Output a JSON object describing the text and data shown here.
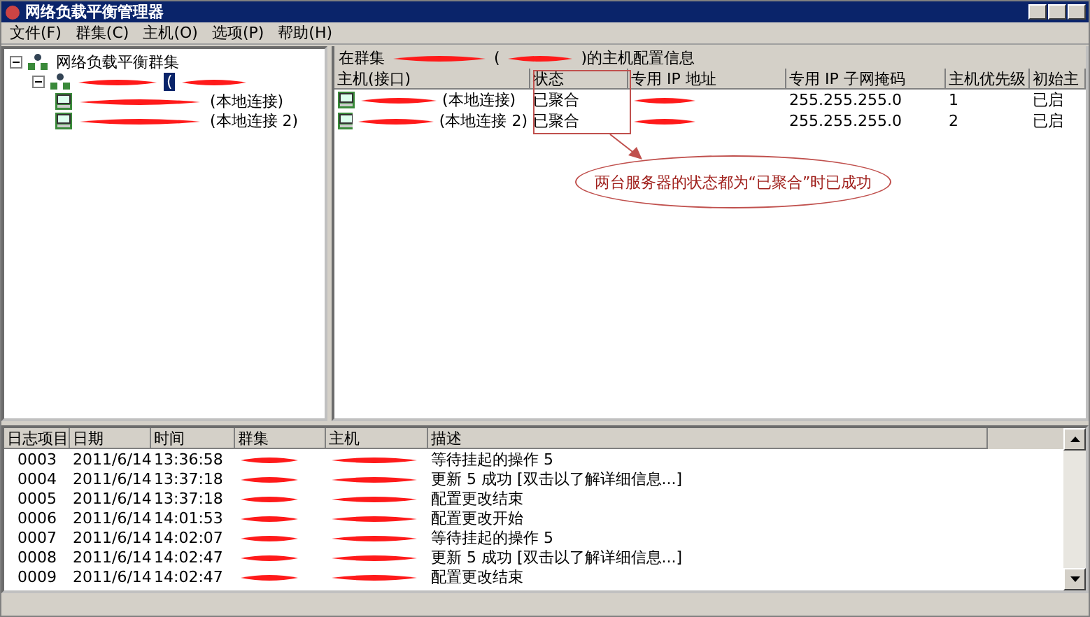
{
  "window": {
    "title": "网络负载平衡管理器"
  },
  "menu": [
    "文件(F)",
    "群集(C)",
    "主机(O)",
    "选项(P)",
    "帮助(H)"
  ],
  "tree": {
    "label": "网络负载平衡群集",
    "expanded": true,
    "children": [
      {
        "label": "(",
        "selected": true,
        "expanded": true,
        "children": [
          {
            "label": "(本地连接)",
            "selected": false
          },
          {
            "label": "(本地连接 2)",
            "selected": false
          }
        ]
      }
    ]
  },
  "hosts_panel": {
    "title_parts": [
      "在群集",
      "(",
      ")的主机配置信息"
    ],
    "columns": [
      "主机(接口)",
      "状态",
      "专用 IP 地址",
      "专用 IP 子网掩码",
      "主机优先级",
      "初始主"
    ],
    "rows": [
      {
        "host": "(本地连接)",
        "status": "已聚合",
        "mask": "255.255.255.0",
        "priority": "1",
        "initial": "已启"
      },
      {
        "host": "(本地连接 2)",
        "status": "已聚合",
        "mask": "255.255.255.0",
        "priority": "2",
        "initial": "已启"
      }
    ],
    "annotation": "两台服务器的状态都为“已聚合”时已成功"
  },
  "log": {
    "columns": [
      "日志项目",
      "日期",
      "时间",
      "群集",
      "主机",
      "描述"
    ],
    "rows": [
      {
        "id": "0003",
        "date": "2011/6/14",
        "time": "13:36:58",
        "description": "等待挂起的操作 5"
      },
      {
        "id": "0004",
        "date": "2011/6/14",
        "time": "13:37:18",
        "description": "更新 5 成功 [双击以了解详细信息...]"
      },
      {
        "id": "0005",
        "date": "2011/6/14",
        "time": "13:37:18",
        "description": "配置更改结束"
      },
      {
        "id": "0006",
        "date": "2011/6/14",
        "time": "14:01:53",
        "description": "配置更改开始"
      },
      {
        "id": "0007",
        "date": "2011/6/14",
        "time": "14:02:07",
        "description": "等待挂起的操作 5"
      },
      {
        "id": "0008",
        "date": "2011/6/14",
        "time": "14:02:47",
        "description": "更新 5 成功 [双击以了解详细信息...]"
      },
      {
        "id": "0009",
        "date": "2011/6/14",
        "time": "14:02:47",
        "description": "配置更改结束"
      }
    ]
  }
}
